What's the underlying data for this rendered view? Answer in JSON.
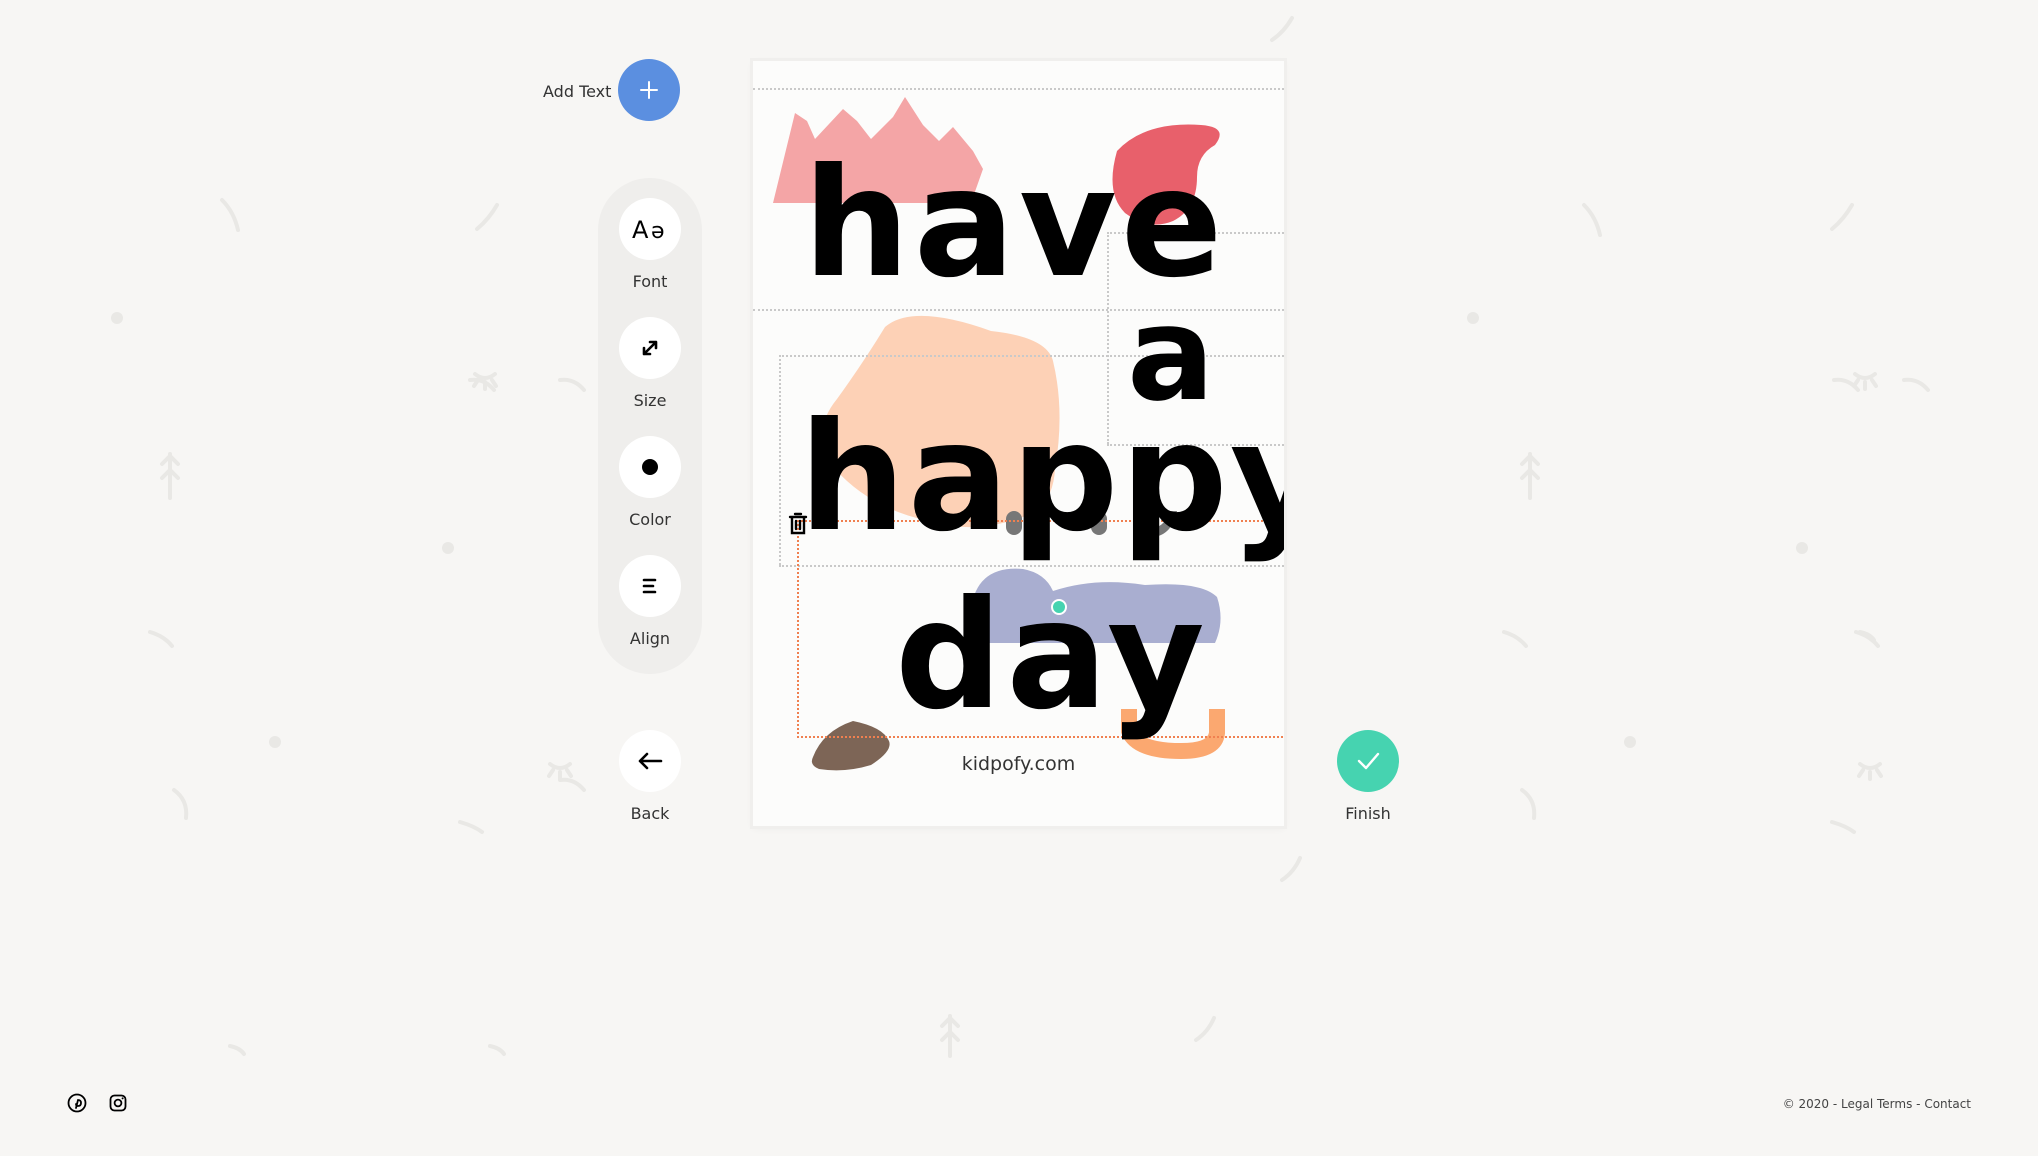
{
  "add_text": {
    "label": "Add Text",
    "icon": "plus-icon"
  },
  "toolbar": {
    "items": [
      {
        "label": "Font",
        "icon": "font-icon"
      },
      {
        "label": "Size",
        "icon": "resize-icon"
      },
      {
        "label": "Color",
        "icon": "dot-icon"
      },
      {
        "label": "Align",
        "icon": "align-icon"
      }
    ]
  },
  "nav": {
    "back_label": "Back",
    "finish_label": "Finish"
  },
  "card": {
    "words": [
      "have",
      "a",
      "happy",
      "day"
    ],
    "site": "kidpofy.com",
    "colors": {
      "pink": "#f4a5a6",
      "red": "#e8606b",
      "peach": "#fdd1b6",
      "lavender": "#a9aed0",
      "brown": "#7d6556",
      "orange": "#fba870"
    }
  },
  "footer": {
    "copyright": "© 2020",
    "legal_terms": "Legal Terms",
    "contact": "Contact",
    "separator": " - "
  },
  "accent": {
    "blue": "#5b8fe0",
    "teal": "#46d3b0",
    "selection": "#f08050"
  }
}
